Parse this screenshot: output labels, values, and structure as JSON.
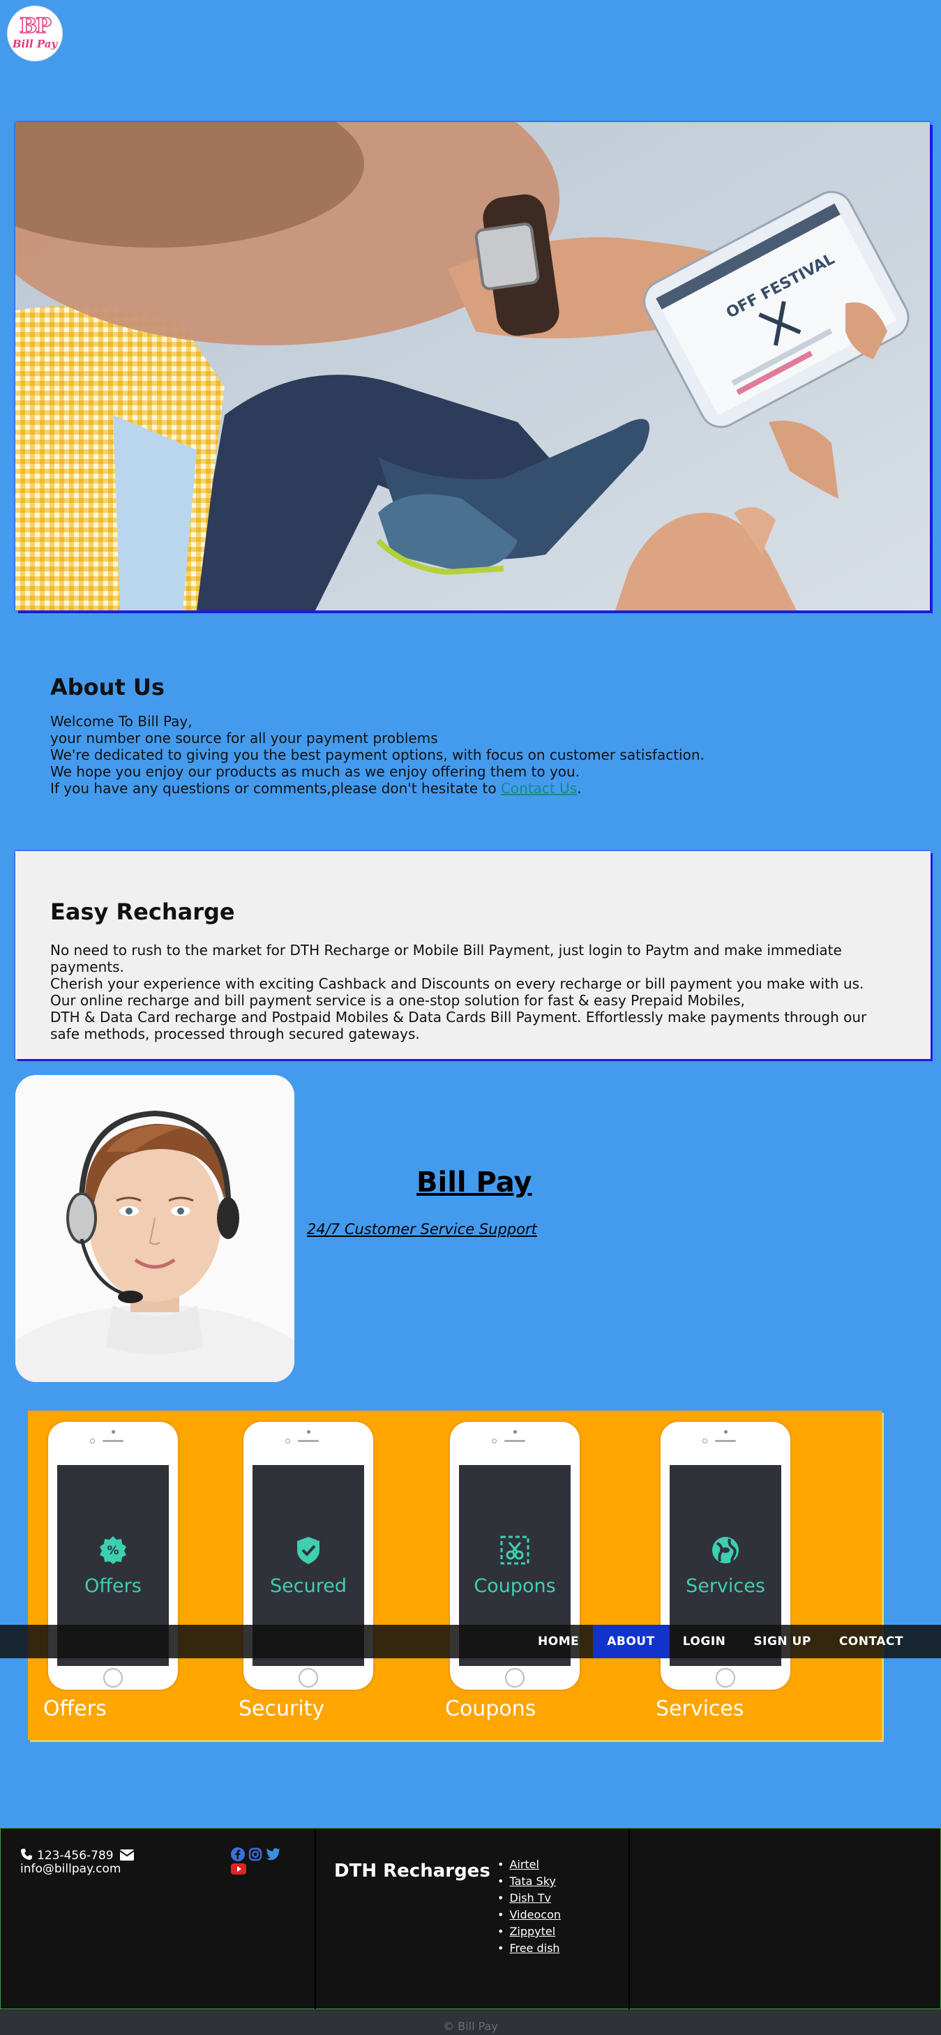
{
  "brand": {
    "logo_letters": "BP",
    "logo_text": "Bill Pay"
  },
  "about": {
    "heading": "About Us",
    "lines": [
      "Welcome To Bill Pay,",
      "your number one source for all your payment problems",
      "We're dedicated to giving you the best payment options, with focus on customer satisfaction.",
      "We hope you enjoy our products as much as we enjoy offering them to you."
    ],
    "last_line_prefix": "If you have any questions or comments,please don't hesitate to ",
    "contact_link": "Contact Us",
    "last_line_suffix": "."
  },
  "recharge": {
    "heading": "Easy Recharge",
    "lines": [
      "No need to rush to the market for DTH Recharge or Mobile Bill Payment, just login to Paytm and make immediate payments.",
      "Cherish your experience with exciting Cashback and Discounts on every recharge or bill payment you make with us.",
      "Our online recharge and bill payment service is a one-stop solution for fast & easy Prepaid Mobiles,",
      "DTH & Data Card recharge and Postpaid Mobiles & Data Cards Bill Payment. Effortlessly make payments through our safe methods, processed through secured gateways."
    ]
  },
  "support": {
    "title": "Bill Pay",
    "subtitle": "24/7 Customer Service Support"
  },
  "services": {
    "phones": [
      {
        "screen_label": "Offers",
        "icon": "percent-badge-icon",
        "caption": "Offers"
      },
      {
        "screen_label": "Secured",
        "icon": "shield-check-icon",
        "caption": "Security"
      },
      {
        "screen_label": "Coupons",
        "icon": "scissors-coupon-icon",
        "caption": "Coupons"
      },
      {
        "screen_label": "Services",
        "icon": "globe-icon",
        "caption": "Services"
      }
    ]
  },
  "nav": {
    "items": [
      "HOME",
      "ABOUT",
      "LOGIN",
      "SIGN UP",
      "CONTACT"
    ],
    "active": "ABOUT"
  },
  "footer": {
    "phone": "123-456-789",
    "email": "info@billpay.com",
    "social_icons": [
      "facebook-icon",
      "instagram-icon",
      "twitter-icon",
      "youtube-icon"
    ],
    "dth_title": "DTH Recharges",
    "dth_links": [
      "Airtel",
      "Tata Sky",
      "Dish Tv",
      "Videocon",
      "Zippytel",
      "Free dish"
    ],
    "copyright": "© Bill Pay"
  },
  "colors": {
    "page_bg": "#449bee",
    "accent_teal": "#3ecfb0",
    "services_bg": "#ffa500",
    "nav_active": "#1133cc",
    "footer_bg": "#121212"
  }
}
